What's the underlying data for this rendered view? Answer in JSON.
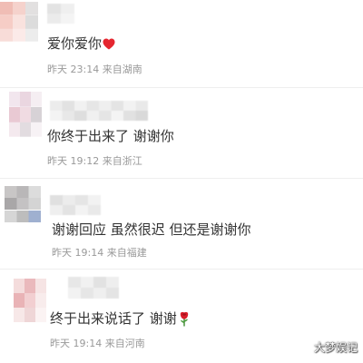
{
  "theme": {
    "text": "#333333",
    "meta": "#999999",
    "heart": "#e5262f",
    "separator": "#eeeeee"
  },
  "comments": [
    {
      "text": "爱你爱你",
      "emoji": "heart-icon",
      "time": "昨天 23:14",
      "location": "来自湖南"
    },
    {
      "text": "你终于出来了 谢谢你",
      "time": "昨天 19:12",
      "location": "来自浙江"
    },
    {
      "text": "谢谢回应 虽然很迟 但还是谢谢你",
      "time": "昨天 19:14",
      "location": "来自福建"
    },
    {
      "text": "终于出来说话了 谢谢",
      "emoji": "rose-icon",
      "time": "昨天 19:14",
      "location": "来自河南"
    }
  ],
  "watermark": "大梦娱记"
}
